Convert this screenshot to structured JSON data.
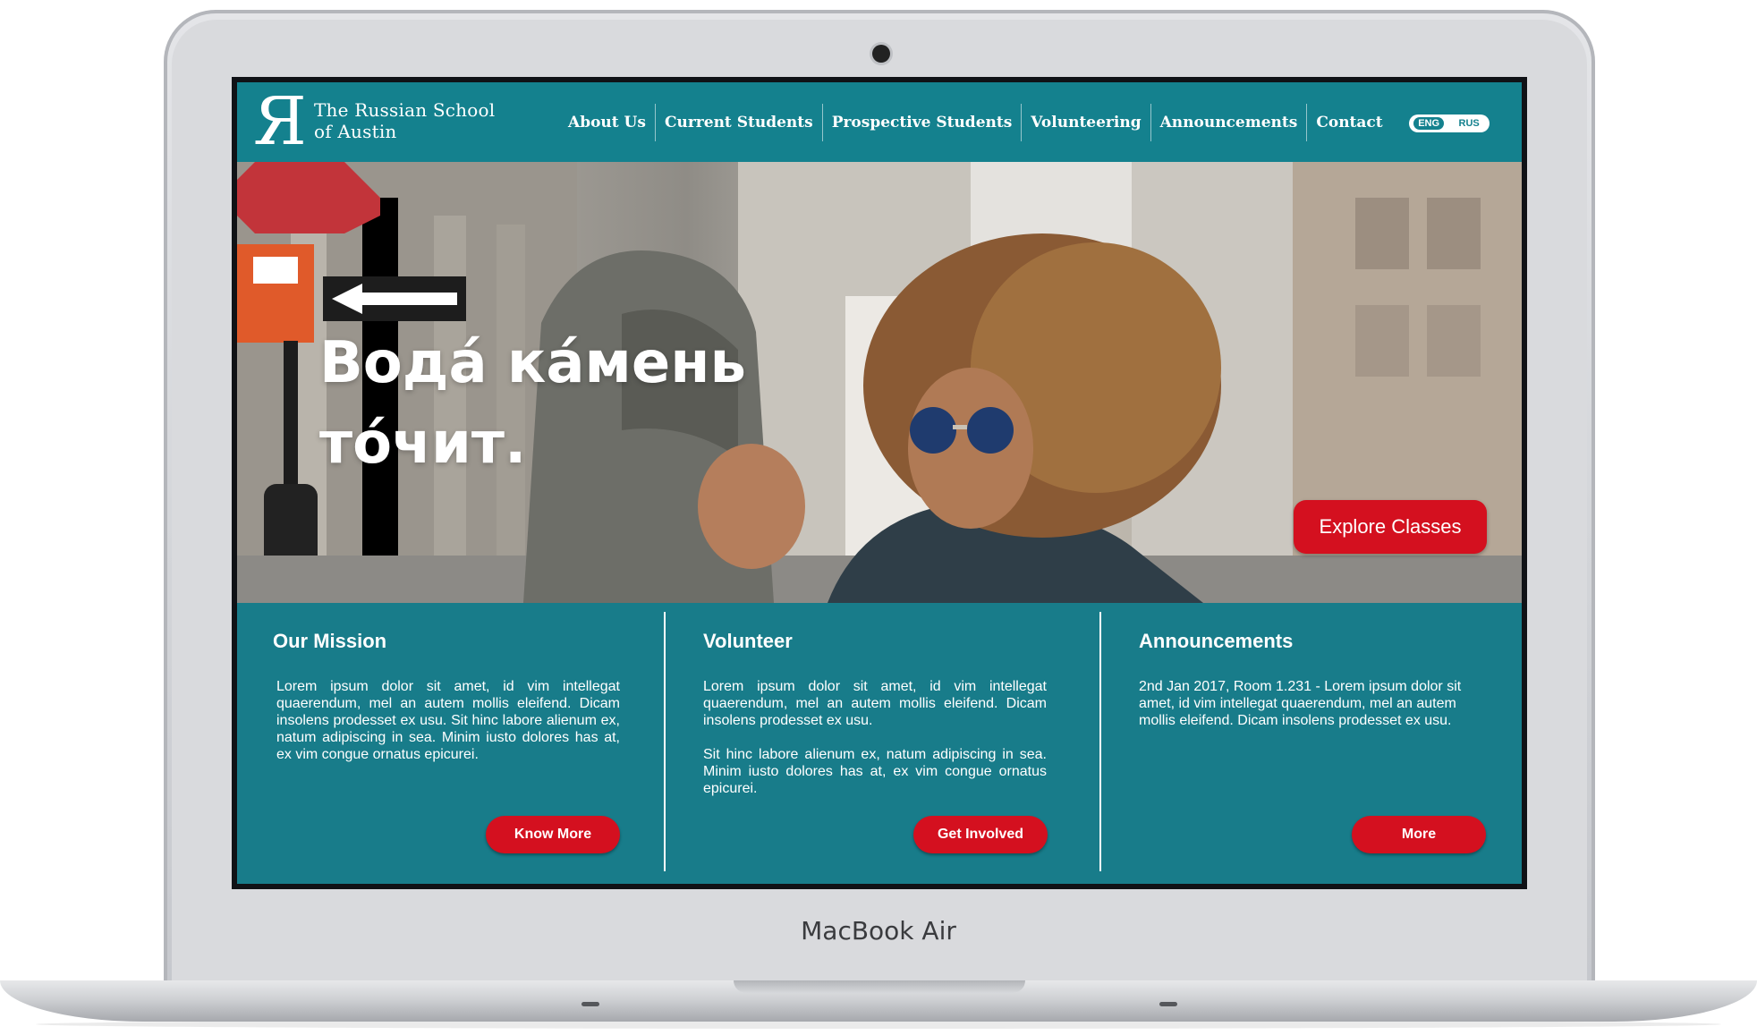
{
  "device": {
    "label": "MacBook Air"
  },
  "site": {
    "logo_mark": "Я",
    "logo_line1": "The Russian School",
    "logo_line2": "of Austin"
  },
  "nav": {
    "items": [
      {
        "label": "About Us"
      },
      {
        "label": "Current Students"
      },
      {
        "label": "Prospective Students"
      },
      {
        "label": "Volunteering"
      },
      {
        "label": "Announcements"
      },
      {
        "label": "Contact"
      }
    ],
    "lang_active": "ENG",
    "lang_other": "RUS"
  },
  "hero": {
    "line1": "Водá кáмень",
    "line2": "тóчит.",
    "cta": "Explore Classes"
  },
  "panels": [
    {
      "title": "Our Mission",
      "body": [
        "Lorem ipsum dolor sit amet, id vim intellegat quaerendum, mel an autem mollis eleifend. Dicam insolens prodesset ex usu. Sit hinc labore alienum ex, natum adipiscing in sea. Minim iusto dolores has at, ex vim congue ornatus epicurei."
      ],
      "button": "Know More"
    },
    {
      "title": "Volunteer",
      "body": [
        "Lorem ipsum dolor sit amet, id vim intellegat quaerendum, mel an autem mollis eleifend. Dicam insolens prodesset ex usu.",
        "Sit hinc labore alienum ex, natum adipiscing in sea. Minim iusto dolores has at, ex vim congue ornatus epicurei."
      ],
      "button": "Get Involved"
    },
    {
      "title": "Announcements",
      "body": [
        "2nd Jan 2017, Room 1.231 - Lorem ipsum dolor sit amet, id vim intellegat quaerendum, mel an autem mollis eleifend. Dicam insolens prodesset ex usu."
      ],
      "button": "More"
    }
  ],
  "colors": {
    "teal": "#14818e",
    "panel_teal": "#187c8a",
    "accent_red": "#d4101f"
  }
}
